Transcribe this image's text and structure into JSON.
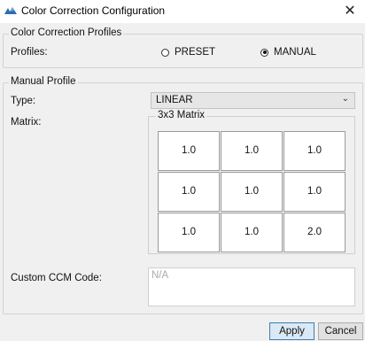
{
  "window": {
    "title": "Color Correction Configuration",
    "close_glyph": "✕",
    "app_icon": "app-logo-icon"
  },
  "profiles_group": {
    "legend": "Color Correction Profiles",
    "label": "Profiles:",
    "options": [
      {
        "label": "PRESET",
        "selected": false
      },
      {
        "label": "MANUAL",
        "selected": true
      }
    ]
  },
  "manual_group": {
    "legend": "Manual Profile",
    "type_label": "Type:",
    "type_value": "LINEAR",
    "matrix_label": "Matrix:",
    "matrix_legend": "3x3 Matrix",
    "matrix": [
      [
        "1.0",
        "1.0",
        "1.0"
      ],
      [
        "1.0",
        "1.0",
        "1.0"
      ],
      [
        "1.0",
        "1.0",
        "2.0"
      ]
    ],
    "ccm_label": "Custom CCM Code:",
    "ccm_placeholder": "N/A"
  },
  "buttons": {
    "apply": "Apply",
    "cancel": "Cancel"
  },
  "colors": {
    "apply_bg": "#dbe8f5",
    "apply_border": "#3c7fb1",
    "logo": "#2b6cb0"
  }
}
